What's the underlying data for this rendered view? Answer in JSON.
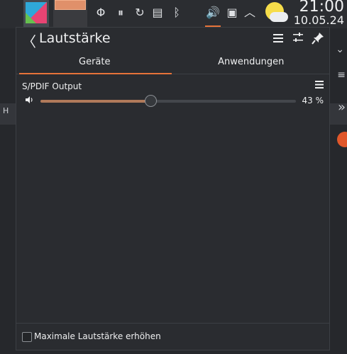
{
  "panel": {
    "tray_icons": [
      "Φ",
      "⏸",
      "↻",
      "▤",
      "ᛒ",
      "🔊",
      "▣",
      "︿"
    ],
    "tray_icon_names": [
      "kdeconnect-icon",
      "media-player-icon",
      "updates-icon",
      "clipboard-icon",
      "bluetooth-icon",
      "volume-icon",
      "network-icon",
      "expand-tray-icon"
    ],
    "clock": {
      "time": "21:00",
      "date": "10.05.24"
    }
  },
  "popup": {
    "title": "Lautstärke",
    "back_glyph": "〈",
    "tabs": [
      {
        "label": "Geräte",
        "active": true
      },
      {
        "label": "Anwendungen",
        "active": false
      }
    ],
    "device": {
      "name": "S/PDIF Output",
      "volume_percent": 43,
      "volume_label": "43 %"
    },
    "footer": {
      "checkbox_label": "Maximale Lautstärke erhöhen",
      "checked": false
    }
  },
  "background": {
    "left_text": "H",
    "colors": {
      "accent": "#e6733a",
      "red_badge": "#e0572a"
    }
  }
}
